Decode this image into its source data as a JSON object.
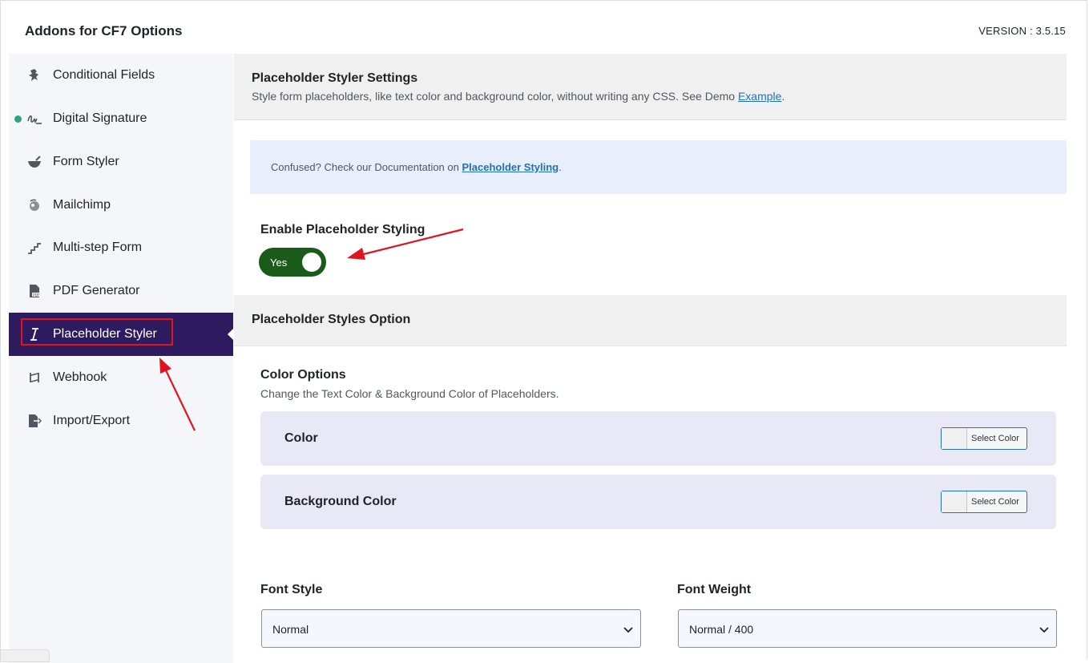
{
  "header": {
    "title": "Addons for CF7 Options",
    "version": "VERSION : 3.5.15"
  },
  "sidebar": {
    "items": [
      {
        "label": "Conditional Fields",
        "icon": "conditional-fields-icon"
      },
      {
        "label": "Digital Signature",
        "icon": "signature-icon"
      },
      {
        "label": "Form Styler",
        "icon": "form-styler-icon"
      },
      {
        "label": "Mailchimp",
        "icon": "mailchimp-icon"
      },
      {
        "label": "Multi-step Form",
        "icon": "multistep-icon"
      },
      {
        "label": "PDF Generator",
        "icon": "pdf-icon"
      },
      {
        "label": "Placeholder Styler",
        "icon": "text-cursor-icon",
        "active": true
      },
      {
        "label": "Webhook",
        "icon": "webhook-icon"
      },
      {
        "label": "Import/Export",
        "icon": "import-export-icon"
      }
    ]
  },
  "main": {
    "settings": {
      "title": "Placeholder Styler Settings",
      "desc": "Style form placeholders, like text color and background color, without writing any CSS. See Demo ",
      "link": "Example",
      "desc_end": "."
    },
    "notice": {
      "text": "Confused? Check our Documentation on ",
      "link": "Placeholder Styling",
      "end": "."
    },
    "enable": {
      "label": "Enable Placeholder Styling",
      "toggle_text": "Yes",
      "on": true
    },
    "styles_option": {
      "title": "Placeholder Styles Option"
    },
    "color_options": {
      "title": "Color Options",
      "desc": "Change the Text Color & Background Color of Placeholders.",
      "rows": [
        {
          "label": "Color",
          "button": "Select Color"
        },
        {
          "label": "Background Color",
          "button": "Select Color"
        }
      ]
    },
    "font_style": {
      "label": "Font Style",
      "value": "Normal"
    },
    "font_weight": {
      "label": "Font Weight",
      "value": "Normal / 400"
    }
  },
  "colors": {
    "active_bg": "#2e1a5e",
    "toggle_on": "#1a5b1a",
    "link": "#2271b1",
    "annotation": "#e0141e",
    "status_dot": "#2ea37a"
  }
}
